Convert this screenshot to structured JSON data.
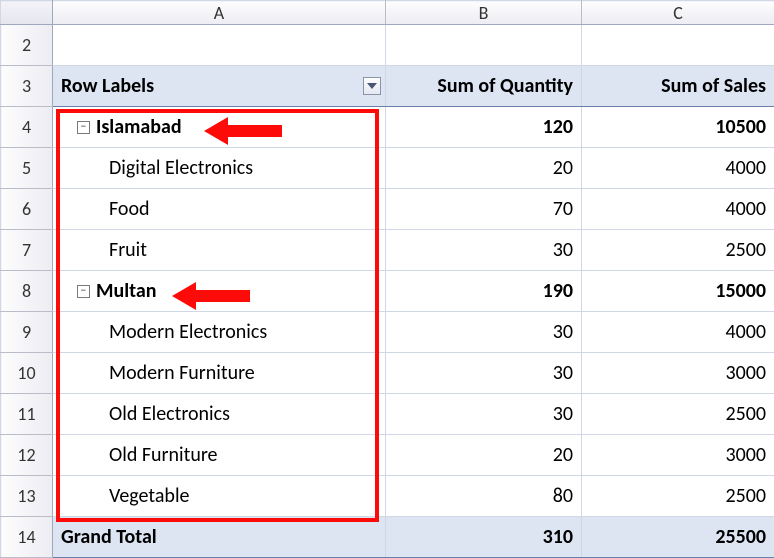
{
  "columns": {
    "A": "A",
    "B": "B",
    "C": "C"
  },
  "rowNums": {
    "r2": "2",
    "r3": "3",
    "r4": "4",
    "r5": "5",
    "r6": "6",
    "r7": "7",
    "r8": "8",
    "r9": "9",
    "r10": "10",
    "r11": "11",
    "r12": "12",
    "r13": "13",
    "r14": "14"
  },
  "header": {
    "rowLabels": "Row Labels",
    "sumQty": "Sum of Quantity",
    "sumSales": "Sum of Sales"
  },
  "groups": [
    {
      "name": "Islamabad",
      "qty": "120",
      "sales": "10500",
      "items": [
        {
          "name": "Digital Electronics",
          "qty": "20",
          "sales": "4000"
        },
        {
          "name": "Food",
          "qty": "70",
          "sales": "4000"
        },
        {
          "name": "Fruit",
          "qty": "30",
          "sales": "2500"
        }
      ]
    },
    {
      "name": "Multan",
      "qty": "190",
      "sales": "15000",
      "items": [
        {
          "name": "Modern Electronics",
          "qty": "30",
          "sales": "4000"
        },
        {
          "name": "Modern Furniture",
          "qty": "30",
          "sales": "3000"
        },
        {
          "name": "Old Electronics",
          "qty": "30",
          "sales": "2500"
        },
        {
          "name": "Old Furniture",
          "qty": "20",
          "sales": "3000"
        },
        {
          "name": "Vegetable",
          "qty": "80",
          "sales": "2500"
        }
      ]
    }
  ],
  "grandTotal": {
    "label": "Grand Total",
    "qty": "310",
    "sales": "25500"
  },
  "collapseGlyph": "−"
}
